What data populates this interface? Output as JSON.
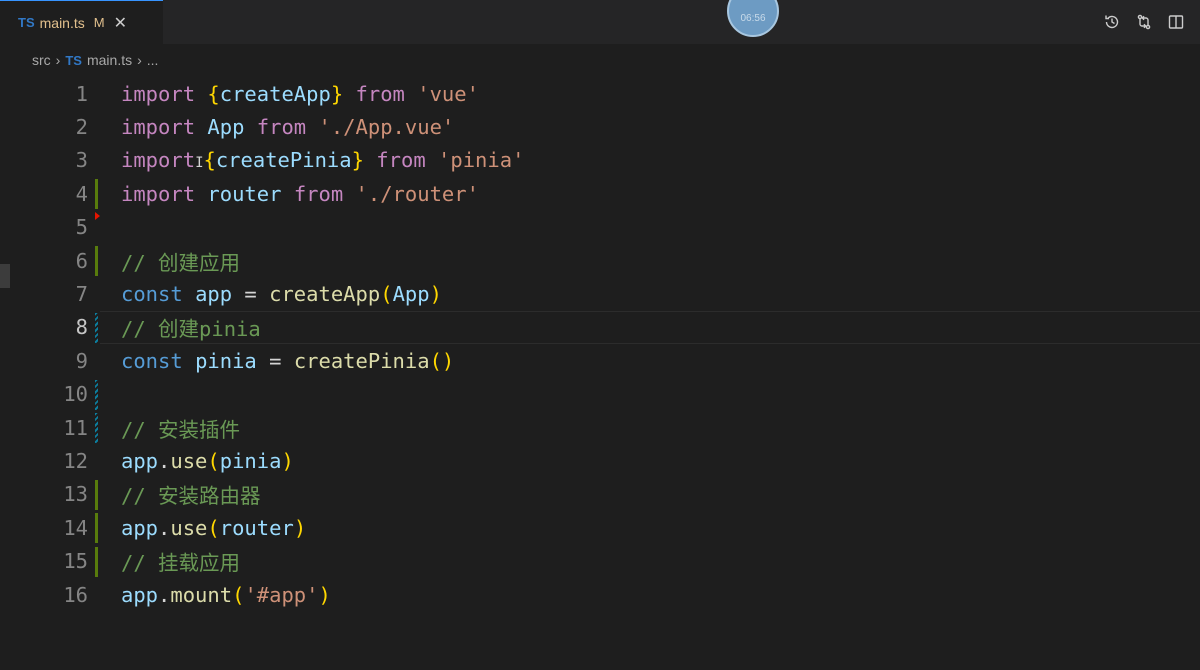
{
  "tab": {
    "lang_badge": "TS",
    "filename": "main.ts",
    "modified_flag": "M",
    "close_glyph": "✕"
  },
  "overlay": {
    "timer": "06:56"
  },
  "actions": {
    "history_icon": "history-icon",
    "compare_icon": "compare-changes-icon",
    "split_icon": "split-editor-icon"
  },
  "breadcrumb": {
    "folder": "src",
    "sep": "›",
    "lang_badge": "TS",
    "file": "main.ts",
    "tail": "..."
  },
  "colors": {
    "keyword": "#c586c0",
    "storage": "#569cd6",
    "variable": "#9cdcfe",
    "function": "#dcdcaa",
    "string": "#ce9178",
    "comment": "#6a9955",
    "gutter_added": "#587c0c",
    "gutter_modified": "#0c7d9d"
  },
  "editor": {
    "active_line": 8,
    "lines": [
      {
        "n": "1",
        "tokens": [
          [
            "kw",
            "import"
          ],
          [
            "pl",
            " "
          ],
          [
            "br1",
            "{"
          ],
          [
            "vr",
            "createApp"
          ],
          [
            "br1",
            "}"
          ],
          [
            "pl",
            " "
          ],
          [
            "kw",
            "from"
          ],
          [
            "pl",
            " "
          ],
          [
            "st",
            "'vue'"
          ]
        ]
      },
      {
        "n": "2",
        "tokens": [
          [
            "kw",
            "import"
          ],
          [
            "pl",
            " "
          ],
          [
            "vr",
            "App"
          ],
          [
            "pl",
            " "
          ],
          [
            "kw",
            "from"
          ],
          [
            "pl",
            " "
          ],
          [
            "st",
            "'./App.vue'"
          ]
        ]
      },
      {
        "n": "3",
        "tokens": [
          [
            "kw",
            "import"
          ],
          [
            "ib",
            "I"
          ],
          [
            "br1",
            "{"
          ],
          [
            "vr",
            "createPinia"
          ],
          [
            "br1",
            "}"
          ],
          [
            "pl",
            " "
          ],
          [
            "kw",
            "from"
          ],
          [
            "pl",
            " "
          ],
          [
            "st",
            "'pinia'"
          ]
        ]
      },
      {
        "n": "4",
        "tokens": [
          [
            "kw",
            "import"
          ],
          [
            "pl",
            " "
          ],
          [
            "vr",
            "router"
          ],
          [
            "pl",
            " "
          ],
          [
            "kw",
            "from"
          ],
          [
            "pl",
            " "
          ],
          [
            "st",
            "'./router'"
          ]
        ]
      },
      {
        "n": "5",
        "tokens": []
      },
      {
        "n": "6",
        "tokens": [
          [
            "cm",
            "// 创建应用"
          ]
        ]
      },
      {
        "n": "7",
        "tokens": [
          [
            "sk",
            "const"
          ],
          [
            "pl",
            " "
          ],
          [
            "vr",
            "app"
          ],
          [
            "pl",
            " = "
          ],
          [
            "fn",
            "createApp"
          ],
          [
            "br1",
            "("
          ],
          [
            "vr",
            "App"
          ],
          [
            "br1",
            ")"
          ]
        ]
      },
      {
        "n": "8",
        "tokens": [
          [
            "cm",
            "// 创建pinia"
          ]
        ]
      },
      {
        "n": "9",
        "tokens": [
          [
            "sk",
            "const"
          ],
          [
            "pl",
            " "
          ],
          [
            "vr",
            "pinia"
          ],
          [
            "pl",
            " = "
          ],
          [
            "fn",
            "createPinia"
          ],
          [
            "br1",
            "()"
          ]
        ]
      },
      {
        "n": "10",
        "tokens": []
      },
      {
        "n": "11",
        "tokens": [
          [
            "cm",
            "// 安装插件"
          ]
        ]
      },
      {
        "n": "12",
        "tokens": [
          [
            "vr",
            "app"
          ],
          [
            "pl",
            "."
          ],
          [
            "fn",
            "use"
          ],
          [
            "br1",
            "("
          ],
          [
            "vr",
            "pinia"
          ],
          [
            "br1",
            ")"
          ]
        ]
      },
      {
        "n": "13",
        "tokens": [
          [
            "cm",
            "// 安装路由器"
          ]
        ]
      },
      {
        "n": "14",
        "tokens": [
          [
            "vr",
            "app"
          ],
          [
            "pl",
            "."
          ],
          [
            "fn",
            "use"
          ],
          [
            "br1",
            "("
          ],
          [
            "vr",
            "router"
          ],
          [
            "br1",
            ")"
          ]
        ]
      },
      {
        "n": "15",
        "tokens": [
          [
            "cm",
            "// 挂载应用"
          ]
        ]
      },
      {
        "n": "16",
        "tokens": [
          [
            "vr",
            "app"
          ],
          [
            "pl",
            "."
          ],
          [
            "fn",
            "mount"
          ],
          [
            "br1",
            "("
          ],
          [
            "st",
            "'#app'"
          ],
          [
            "br1",
            ")"
          ]
        ]
      }
    ]
  }
}
